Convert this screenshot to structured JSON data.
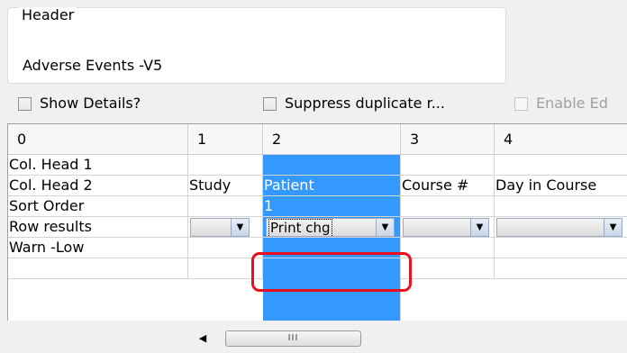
{
  "header_group": {
    "legend": "Header",
    "value": "Adverse Events -V5"
  },
  "checkboxes": [
    {
      "label": "Show Details?",
      "checked": false,
      "enabled": true
    },
    {
      "label": "Suppress duplicate r...",
      "checked": false,
      "enabled": true
    },
    {
      "label": "Enable Ed",
      "checked": false,
      "enabled": false
    }
  ],
  "grid": {
    "columns": [
      "0",
      "1",
      "2",
      "3",
      "4"
    ],
    "rows": [
      {
        "label": "Col. Head 1",
        "cells": [
          "",
          "",
          "",
          ""
        ]
      },
      {
        "label": "Col. Head 2",
        "cells": [
          "Study",
          "Patient",
          "Course #",
          "Day in Course"
        ]
      },
      {
        "label": "Sort Order",
        "cells": [
          "",
          "1",
          "",
          ""
        ]
      },
      {
        "label": "Row results",
        "cells": [
          "",
          "Print chg",
          "",
          ""
        ]
      },
      {
        "label": "Warn -Low",
        "cells": [
          "",
          "",
          "",
          ""
        ]
      },
      {
        "label": "",
        "cells": [
          "",
          "",
          "",
          ""
        ]
      }
    ],
    "selected_column": "2",
    "dropdown_arrow": "dropdown-arrow-icon"
  },
  "scrollbar": {
    "left_arrow": "◀",
    "right_arrow": "▶",
    "grip": "III"
  },
  "colors": {
    "selection": "#3399ff",
    "highlight": "#e8101e"
  }
}
